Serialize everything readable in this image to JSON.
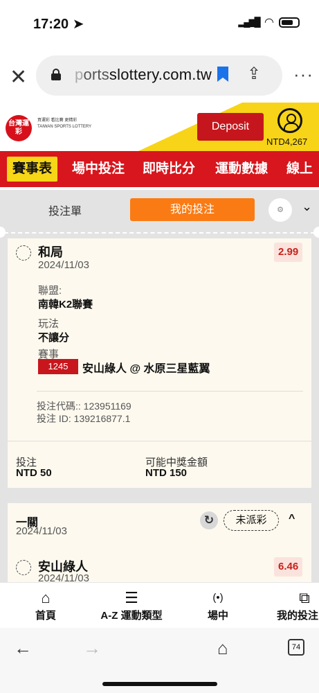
{
  "status_bar": {
    "time": "17:20 ➤",
    "signal": "▂▄▆█",
    "wifi": "wifi"
  },
  "browser": {
    "url_faded": "p",
    "url_light": "orts",
    "url_dark": "slottery.com.tw",
    "tab_count": "74"
  },
  "site": {
    "logo_text": "台灣運彩",
    "logo_tagline": "買運彩 看比賽 更精彩 TAIWAN SPORTS LOTTERY",
    "deposit_label": "Deposit",
    "balance": "NTD4,267"
  },
  "nav": {
    "tabs": [
      {
        "label": "賽事表"
      },
      {
        "label": "場中投注"
      },
      {
        "label": "即時比分"
      },
      {
        "label": "運動數據"
      },
      {
        "label": "線上"
      }
    ]
  },
  "bet_panel": {
    "tab_betslip": "投注單",
    "tab_mybets": "我的投注",
    "settings_icon": "⚙"
  },
  "bet1": {
    "selection": "和局",
    "date": "2024/11/03",
    "odds": "2.99",
    "league_label": "聯盟:",
    "league": "南韓K2聯賽",
    "market_label": "玩法",
    "market": "不讓分",
    "event_label": "賽事",
    "event_number": "1245",
    "event_name": "安山綠人 @ 水原三星藍翼",
    "bet_code": "投注代碼:: 123951169",
    "bet_id": "投注 ID: 139216877.1",
    "stake_label": "投注",
    "stake": "NTD 50",
    "payout_label": "可能中獎金額",
    "payout": "NTD 150"
  },
  "bet2": {
    "type": "一關",
    "date": "2024/11/03",
    "status": "未派彩",
    "selection": "安山綠人",
    "selection_date": "2024/11/03",
    "odds": "6.46"
  },
  "bottom_nav": [
    {
      "label": "首頁",
      "icon": "home-icon"
    },
    {
      "label": "A-Z 運動類型",
      "icon": "menu-icon"
    },
    {
      "label": "場中",
      "icon": "live-icon"
    },
    {
      "label": "我的投注",
      "icon": "copy-icon"
    }
  ]
}
